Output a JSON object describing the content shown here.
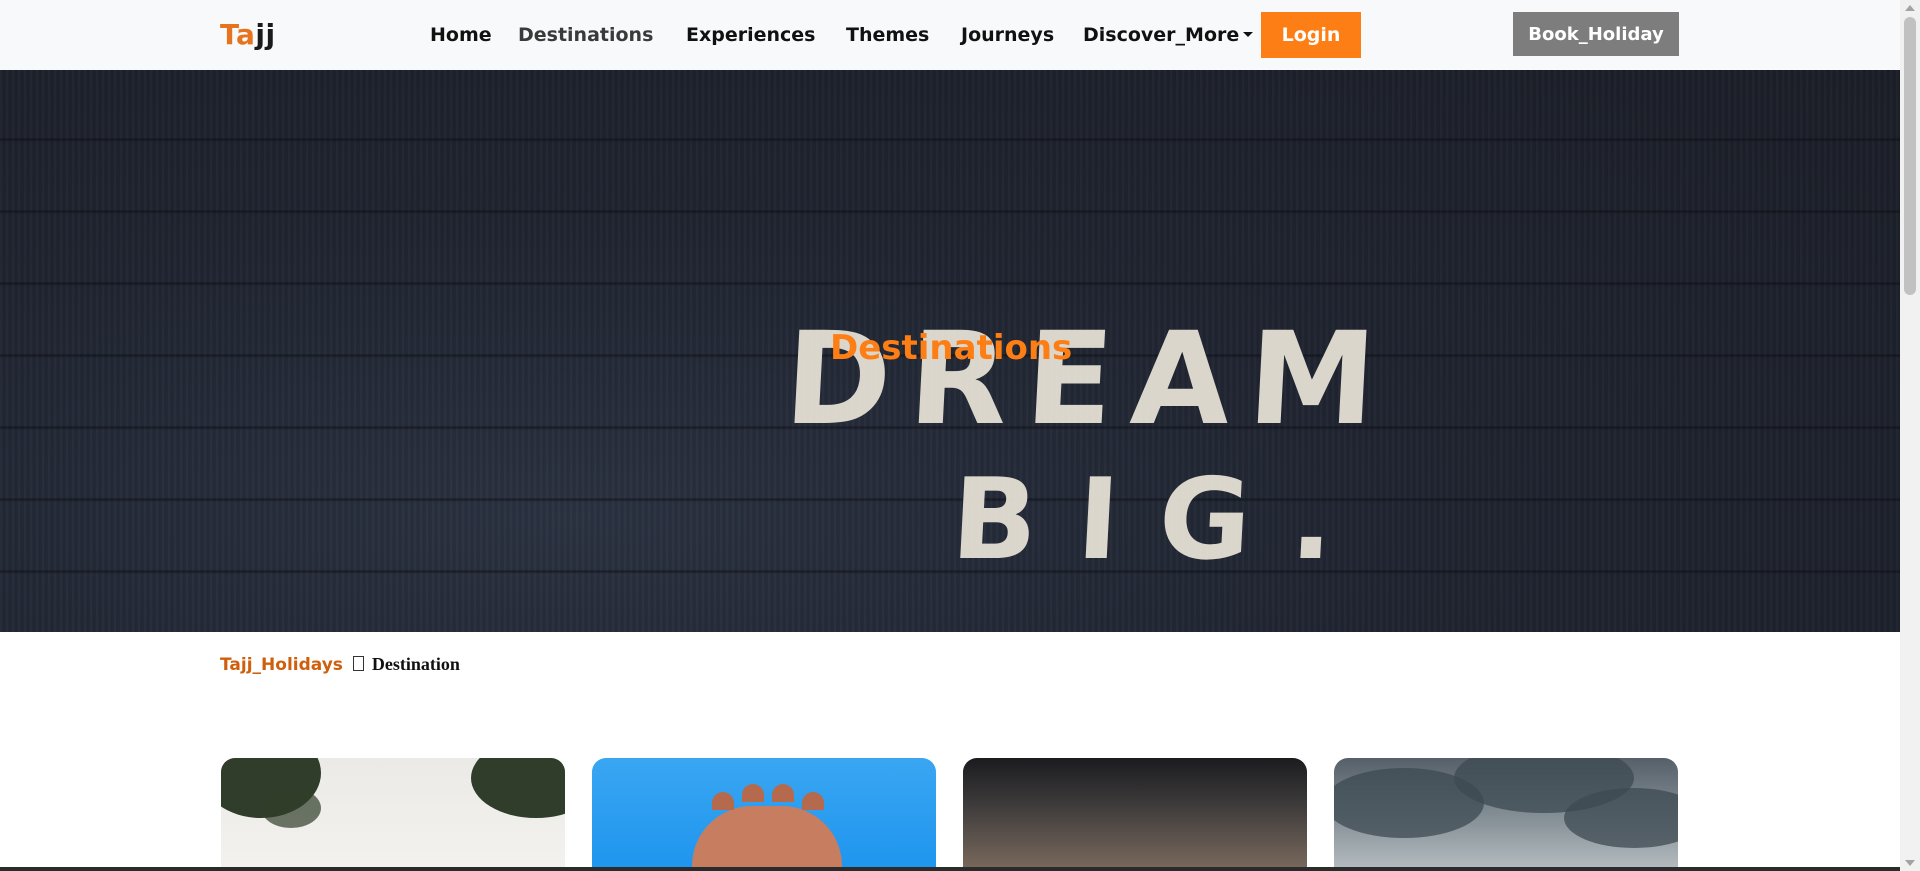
{
  "brand": {
    "part1": "Ta",
    "part2": "jj"
  },
  "nav": {
    "home": "Home",
    "destinations": "Destinations",
    "experiences": "Experiences",
    "themes": "Themes",
    "journeys": "Journeys",
    "discover_more": "Discover_More",
    "login": "Login",
    "book_holiday": "Book_Holiday"
  },
  "hero": {
    "title": "Destinations",
    "image_text_line1": "DREAM",
    "image_text_line2": "BIG."
  },
  "breadcrumb": {
    "parent": "Tajj_Holidays",
    "current": "Destination"
  },
  "colors": {
    "accent": "#fd7e14",
    "book_button": "#7d7d7d",
    "navbar_bg": "#f8f9fa"
  },
  "icons": {
    "dropdown": "chevron-down-icon",
    "breadcrumb_separator": "missing-glyph-icon"
  }
}
